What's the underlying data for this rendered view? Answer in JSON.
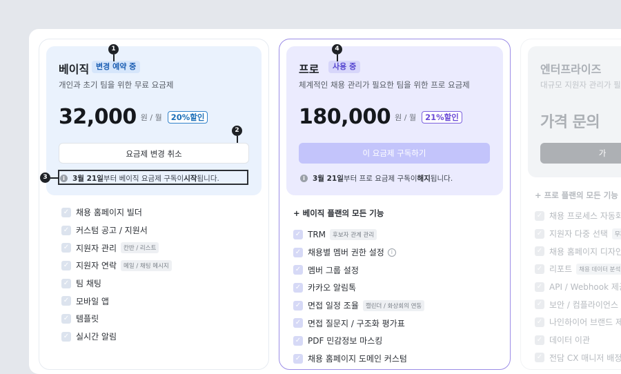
{
  "basic": {
    "name": "베이직",
    "badge": "변경 예약 중",
    "desc": "개인과 초기 팀을 위한 무료 요금제",
    "price": "32,000",
    "unit": "원 / 월",
    "discount": "20%할인",
    "cta": "요금제 변경 취소",
    "notice_date": "3월 21일",
    "notice_mid": " 부터 베이직 요금제 구독이 ",
    "notice_bold": "시작",
    "notice_end": "됩니다.",
    "features": [
      {
        "label": "채용 홈페이지 빌더",
        "tag": ""
      },
      {
        "label": "커스텀 공고 / 지원서",
        "tag": ""
      },
      {
        "label": "지원자 관리",
        "tag": "칸반 / 리스트"
      },
      {
        "label": "지원자 연락",
        "tag": "메일 / 채팅 메시지"
      },
      {
        "label": "팀 채팅",
        "tag": ""
      },
      {
        "label": "모바일 앱",
        "tag": ""
      },
      {
        "label": "템플릿",
        "tag": ""
      },
      {
        "label": "실시간 알림",
        "tag": ""
      }
    ]
  },
  "pro": {
    "name": "프로",
    "badge": "사용 중",
    "desc": "체계적인 채용 관리가 필요한 팀을 위한 프로 요금제",
    "price": "180,000",
    "unit": "원 / 월",
    "discount": "21%할인",
    "cta": "이 요금제 구독하기",
    "notice_date": "3월 21일",
    "notice_mid": " 부터 프로 요금제 구독이 ",
    "notice_bold": "해지",
    "notice_end": "됩니다.",
    "section": "+ 베이직 플랜의 모든 기능",
    "features": [
      {
        "label": "TRM",
        "tag": "후보자 관계 관리"
      },
      {
        "label": "채용별 멤버 권한 설정",
        "tag": ""
      },
      {
        "label": "멤버 그룹 설정",
        "tag": ""
      },
      {
        "label": "카카오 알림톡",
        "tag": ""
      },
      {
        "label": "면접 일정 조율",
        "tag": "캘린더 / 화상회의 연동"
      },
      {
        "label": "면접 질문지 / 구조화 평가표",
        "tag": ""
      },
      {
        "label": "PDF 민감정보 마스킹",
        "tag": ""
      },
      {
        "label": "채용 홈페이지 도메인 커스텀",
        "tag": ""
      }
    ]
  },
  "enterprise": {
    "name": "엔터프라이즈",
    "desc": "대규모 지원자 관리가 필요한",
    "price": "가격 문의",
    "cta": "가",
    "section": "+ 프로 플랜의 모든 기능",
    "features": [
      {
        "label": "채용 프로세스 자동화",
        "tag": ""
      },
      {
        "label": "지원자 다중 선택",
        "tag": "무제한"
      },
      {
        "label": "채용 홈페이지 디자인 지원",
        "tag": ""
      },
      {
        "label": "리포트",
        "tag": "채용 데이터 분석"
      },
      {
        "label": "API / Webhook 제공",
        "tag": ""
      },
      {
        "label": "보안 / 컴플라이언스 지원",
        "tag": ""
      },
      {
        "label": "나인하이어 브랜드 제거",
        "tag": ""
      },
      {
        "label": "데이터 이관",
        "tag": ""
      },
      {
        "label": "전담 CX 매니저 배정",
        "tag": ""
      }
    ]
  },
  "markers": [
    "1",
    "2",
    "3",
    "4"
  ],
  "icons": {
    "check": "✓",
    "info": "i"
  }
}
